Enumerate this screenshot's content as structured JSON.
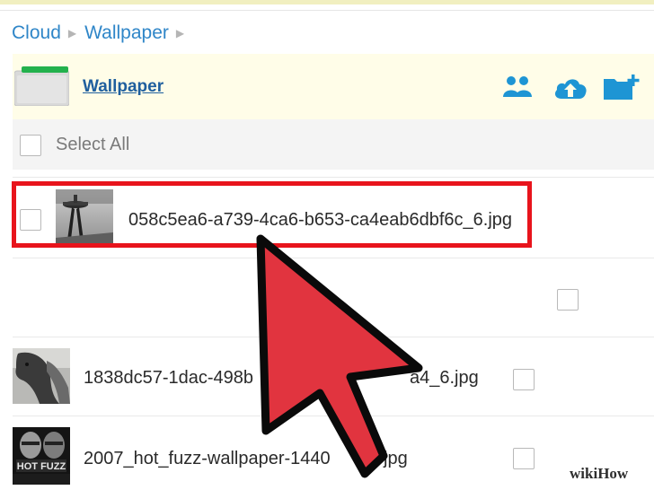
{
  "breadcrumb": {
    "items": [
      "Cloud",
      "Wallpaper"
    ],
    "separator": "▶"
  },
  "folder": {
    "name": "Wallpaper",
    "icons": [
      "share-users-icon",
      "upload-cloud-icon",
      "new-folder-icon"
    ]
  },
  "select_all": {
    "label": "Select All"
  },
  "files": [
    {
      "name": "058c5ea6-a739-4ca6-b653-ca4eab6dbf6c_6.jpg",
      "thumbnail": "space-needle",
      "highlighted": true
    },
    {
      "name": "",
      "thumbnail": "none",
      "highlighted": false
    },
    {
      "name": "1838dc57-1dac-498b",
      "name_tail": "a4_6.jpg",
      "thumbnail": "horse",
      "highlighted": false
    },
    {
      "name": "2007_hot_fuzz-wallpaper-1440",
      "name_tail": "jpg",
      "thumbnail": "movie-poster",
      "highlighted": false
    }
  ],
  "thumbnail_text": {
    "poster_title": "HOT FUZZ"
  },
  "annotation": {
    "box_color": "#e8141c",
    "arrow_color": "#e1343f",
    "arrow_target": "file-1"
  },
  "watermark": {
    "wiki": "wiki",
    "how": "How"
  },
  "colors": {
    "link": "#2f86c8",
    "folder_name": "#1f5f9e",
    "accent_icons": "#1e95d4",
    "folder_tab": "#23b14d",
    "header_bg": "#fffde8"
  }
}
